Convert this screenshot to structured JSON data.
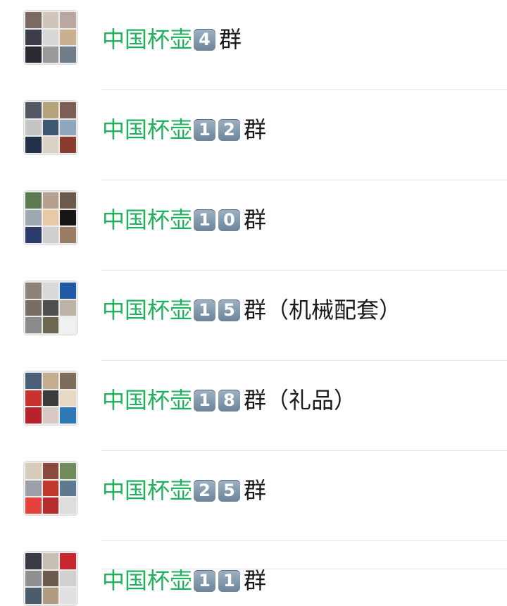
{
  "groups": [
    {
      "keyword": "中国杯壶",
      "digits": [
        "4"
      ],
      "suffix": "群",
      "avatar_colors": [
        "#7a6a62",
        "#cfc5bb",
        "#b9a7a0",
        "#3c3c4a",
        "#d8d8d8",
        "#c8b090",
        "#2b2b34",
        "#9a9a9a",
        "#6f7d8a"
      ]
    },
    {
      "keyword": "中国杯壶",
      "digits": [
        "1",
        "2"
      ],
      "suffix": "群",
      "avatar_colors": [
        "#545864",
        "#b6a37c",
        "#7c5f52",
        "#c5c5c5",
        "#3e5872",
        "#8fa6bd",
        "#223048",
        "#d9d3c7",
        "#8a3d2e"
      ]
    },
    {
      "keyword": "中国杯壶",
      "digits": [
        "1",
        "0"
      ],
      "suffix": "群",
      "avatar_colors": [
        "#5b7a52",
        "#b7a18e",
        "#6b5a49",
        "#9fa9b2",
        "#e8c9a5",
        "#161616",
        "#2b3b6a",
        "#cfcfcf",
        "#9b7d63"
      ]
    },
    {
      "keyword": "中国杯壶",
      "digits": [
        "1",
        "5"
      ],
      "suffix": "群（机械配套）",
      "avatar_colors": [
        "#8d8378",
        "#d9d9d9",
        "#1f5aa6",
        "#7a6d64",
        "#4f4f4f",
        "#bdb3a6",
        "#8a8a8a",
        "#6e6750",
        "#f0f0f0"
      ]
    },
    {
      "keyword": "中国杯壶",
      "digits": [
        "1",
        "8"
      ],
      "suffix": "群（礼品）",
      "avatar_colors": [
        "#4b5e77",
        "#c3ad8e",
        "#7d6d5a",
        "#c8322e",
        "#3b3b3b",
        "#e7d9c4",
        "#b8222a",
        "#d8c9c2",
        "#2f78b8"
      ]
    },
    {
      "keyword": "中国杯壶",
      "digits": [
        "2",
        "5"
      ],
      "suffix": "群",
      "avatar_colors": [
        "#d7ccb9",
        "#8a4a3c",
        "#6f8c5a",
        "#9a9fa8",
        "#c0392b",
        "#5d7a91",
        "#e4423a",
        "#b52c2c",
        "#dddddd"
      ]
    },
    {
      "keyword": "中国杯壶",
      "digits": [
        "1",
        "1"
      ],
      "suffix": "群",
      "avatar_colors": [
        "#3a3a44",
        "#c7bfb4",
        "#c8272d",
        "#8f8f8f",
        "#6b5a4e",
        "#d0d0d0",
        "#4a5b6b",
        "#b09a80",
        "#e0e0e0"
      ]
    }
  ]
}
